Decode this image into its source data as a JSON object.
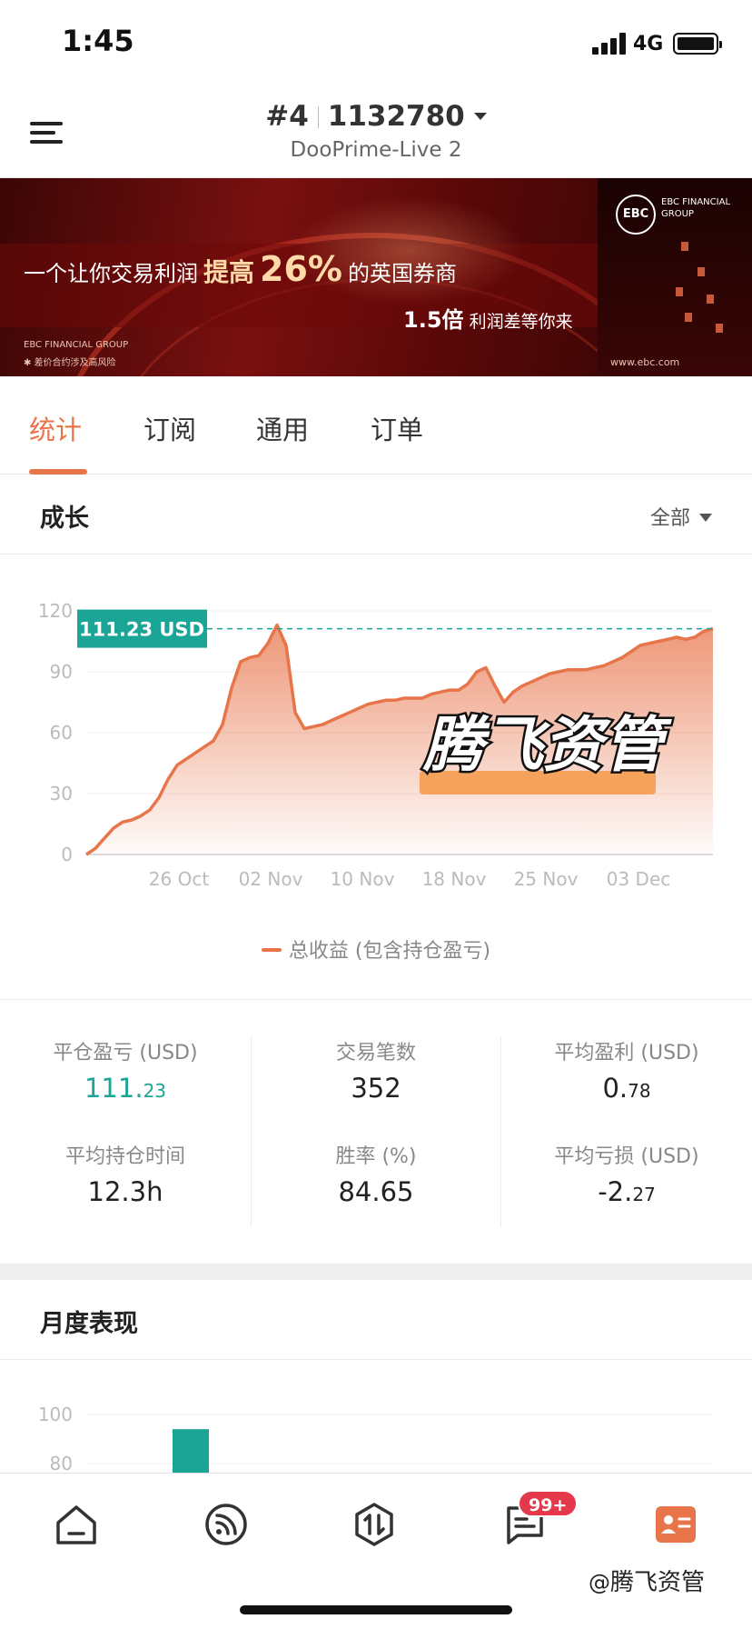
{
  "status_bar": {
    "time": "1:45",
    "network": "4G"
  },
  "header": {
    "rank": "#4",
    "account": "1132780",
    "server": "DooPrime-Live 2"
  },
  "banner": {
    "headline_pre": "一个让你交易利润",
    "headline_mid": "提高",
    "headline_pct": "26%",
    "headline_post": "的英国券商",
    "sub_big": "1.5倍",
    "sub_rest": "利润差等你来",
    "logo_text": "EBC",
    "logo_caption": "EBC FINANCIAL GROUP",
    "group": "EBC FINANCIAL GROUP",
    "risk": "✱ 差价合约涉及高风险",
    "url": "www.ebc.com"
  },
  "tabs": [
    "统计",
    "订阅",
    "通用",
    "订单"
  ],
  "growth": {
    "title": "成长",
    "filter": "全部"
  },
  "chart_data": {
    "type": "area",
    "ylim": [
      0,
      120
    ],
    "yticks": [
      "0",
      "30",
      "60",
      "90",
      "120"
    ],
    "xticks": [
      "26 Oct",
      "02 Nov",
      "10 Nov",
      "18 Nov",
      "25 Nov",
      "03 Dec"
    ],
    "current_label": "111.23 USD",
    "current_value": 111.23,
    "series": [
      {
        "name": "总收益 (包含持仓盈亏)",
        "color": "#e8744a",
        "values": [
          0,
          3,
          8,
          13,
          16,
          17,
          19,
          22,
          28,
          37,
          44,
          47,
          50,
          53,
          56,
          64,
          82,
          95,
          97,
          98,
          104,
          113,
          103,
          70,
          62,
          63,
          64,
          66,
          68,
          70,
          72,
          74,
          75,
          76,
          76,
          77,
          77,
          77,
          79,
          80,
          81,
          81,
          84,
          90,
          92,
          83,
          75,
          80,
          83,
          85,
          87,
          89,
          90,
          91,
          91,
          91,
          92,
          93,
          95,
          97,
          100,
          103,
          104,
          105,
          106,
          107,
          106,
          107,
          110,
          111.23
        ]
      }
    ]
  },
  "watermark": "腾飞资管",
  "stats": [
    {
      "label": "平仓盈亏 (USD)",
      "int": "111.",
      "dec": "23",
      "accent": true
    },
    {
      "label": "交易笔数",
      "int": "352",
      "dec": ""
    },
    {
      "label": "平均盈利 (USD)",
      "int": "0.",
      "dec": "78"
    },
    {
      "label": "平均持仓时间",
      "int": "12.3h",
      "dec": ""
    },
    {
      "label": "胜率 (%)",
      "int": "84.65",
      "dec": ""
    },
    {
      "label": "平均亏损 (USD)",
      "int": "-2.",
      "dec": "27"
    }
  ],
  "monthly": {
    "title": "月度表现",
    "yticks": [
      "100",
      "80"
    ],
    "bar_value": 94,
    "bar_color": "#1aa596"
  },
  "tabbar": {
    "items": [
      "home-icon",
      "feed-icon",
      "trade-icon",
      "message-icon",
      "profile-icon"
    ],
    "badge": "99+",
    "accent": "#e8744a"
  },
  "corner_watermark": {
    "at": "@",
    "name": "腾飞资管"
  }
}
